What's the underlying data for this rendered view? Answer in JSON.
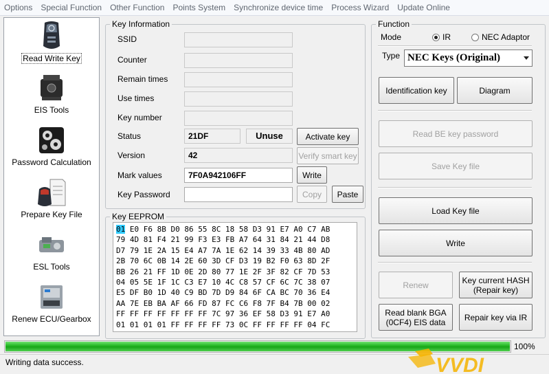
{
  "menu": [
    "Options",
    "Special Function",
    "Other Function",
    "Points System",
    "Synchronize device time",
    "Process Wizard",
    "Update Online"
  ],
  "sidebar": {
    "items": [
      {
        "label": "Read Write Key",
        "icon": "car-key-icon"
      },
      {
        "label": "EIS Tools",
        "icon": "eis-module-icon"
      },
      {
        "label": "Password Calculation",
        "icon": "gears-icon"
      },
      {
        "label": "Prepare Key File",
        "icon": "key-file-icon"
      },
      {
        "label": "ESL Tools",
        "icon": "esl-lock-icon"
      },
      {
        "label": "Renew ECU/Gearbox",
        "icon": "ecu-icon"
      }
    ]
  },
  "key_info": {
    "legend": "Key Information",
    "ssid_label": "SSID",
    "counter_label": "Counter",
    "remain_label": "Remain times",
    "use_label": "Use times",
    "key_number_label": "Key number",
    "status_label": "Status",
    "status_value": "21DF",
    "status_badge": "Unuse",
    "activate_button": "Activate key",
    "version_label": "Version",
    "version_value": "42",
    "verify_button": "Verify smart key",
    "mark_label": "Mark values",
    "mark_value": "7F0A942106FF",
    "write_button": "Write",
    "password_label": "Key Password",
    "copy_button": "Copy",
    "paste_button": "Paste"
  },
  "eeprom": {
    "legend": "Key EEPROM",
    "rows": [
      [
        "01",
        "E0",
        "F6",
        "8B",
        "D0",
        "86",
        "55",
        "8C",
        "18",
        "58",
        "D3",
        "91",
        "E7",
        "A0",
        "C7",
        "AB"
      ],
      [
        "79",
        "4D",
        "81",
        "F4",
        "21",
        "99",
        "F3",
        "E3",
        "FB",
        "A7",
        "64",
        "31",
        "84",
        "21",
        "44",
        "D8"
      ],
      [
        "D7",
        "79",
        "1E",
        "2A",
        "15",
        "E4",
        "A7",
        "7A",
        "1E",
        "62",
        "14",
        "39",
        "33",
        "4B",
        "80",
        "AD"
      ],
      [
        "2B",
        "70",
        "6C",
        "0B",
        "14",
        "2E",
        "60",
        "3D",
        "CF",
        "D3",
        "19",
        "B2",
        "F0",
        "63",
        "8D",
        "2F"
      ],
      [
        "BB",
        "26",
        "21",
        "FF",
        "1D",
        "0E",
        "2D",
        "80",
        "77",
        "1E",
        "2F",
        "3F",
        "82",
        "CF",
        "7D",
        "53"
      ],
      [
        "04",
        "05",
        "5E",
        "1F",
        "1C",
        "C3",
        "E7",
        "10",
        "4C",
        "C8",
        "57",
        "CF",
        "6C",
        "7C",
        "38",
        "07"
      ],
      [
        "E5",
        "DF",
        "B0",
        "1D",
        "40",
        "C9",
        "BD",
        "7D",
        "D9",
        "84",
        "6F",
        "CA",
        "BC",
        "70",
        "36",
        "E4"
      ],
      [
        "AA",
        "7E",
        "EB",
        "BA",
        "AF",
        "66",
        "FD",
        "87",
        "FC",
        "C6",
        "F8",
        "7F",
        "B4",
        "7B",
        "00",
        "02"
      ],
      [
        "FF",
        "FF",
        "FF",
        "FF",
        "FF",
        "FF",
        "FF",
        "7C",
        "97",
        "36",
        "EF",
        "58",
        "D3",
        "91",
        "E7",
        "A0"
      ],
      [
        "01",
        "01",
        "01",
        "01",
        "FF",
        "FF",
        "FF",
        "FF",
        "73",
        "0C",
        "FF",
        "FF",
        "FF",
        "FF",
        "04",
        "FC"
      ]
    ]
  },
  "function": {
    "legend": "Function",
    "mode_label": "Mode",
    "mode_ir": "IR",
    "mode_nec": "NEC Adaptor",
    "mode_selected": "IR",
    "type_label": "Type",
    "type_value": "NEC Keys (Original)",
    "identification_button": "Identification key",
    "diagram_button": "Diagram",
    "read_be_button": "Read BE key password",
    "save_key_button": "Save Key file",
    "load_key_button": "Load Key file",
    "write_button": "Write",
    "renew_button": "Renew",
    "hash_button": "Key current HASH\n(Repair key)",
    "read_blank_button": "Read blank BGA\n(0CF4) EIS data",
    "repair_button": "Repair key via IR"
  },
  "progress": {
    "percent": 100,
    "label": "100%"
  },
  "status_text": "Writing data success.",
  "watermark": "VVDI"
}
